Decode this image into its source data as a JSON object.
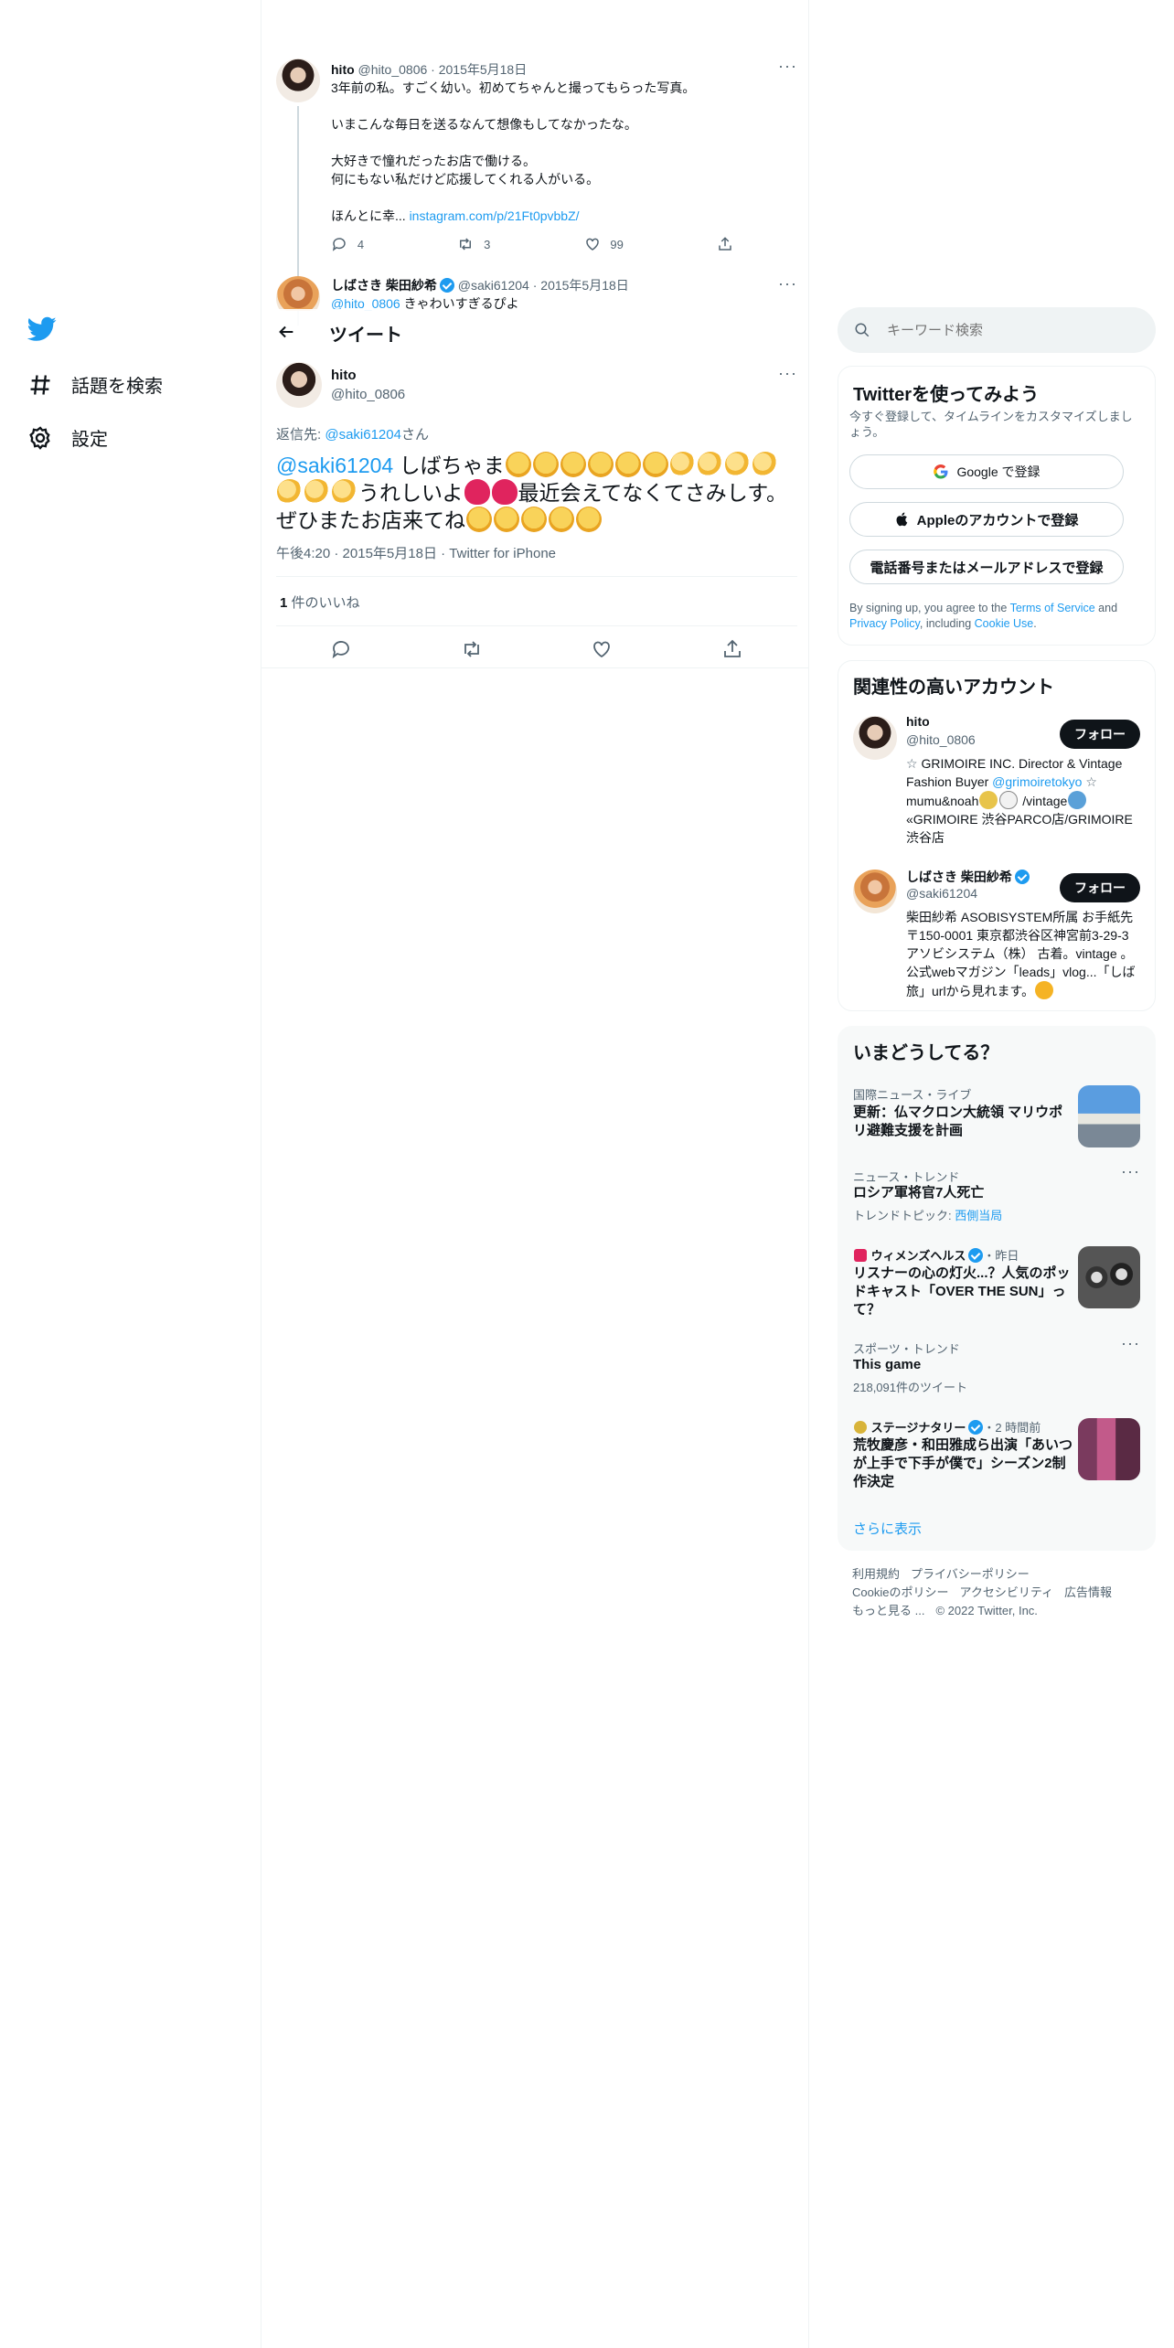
{
  "sidebar": {
    "explore_label": "話題を検索",
    "settings_label": "設定"
  },
  "thread_tweet": {
    "display_name": "hito",
    "handle": "@hito_0806",
    "date": "2015年5月18日",
    "line1": "3年前の私。すごく幼い。初めてちゃんと撮ってもらった写真。",
    "line2": "いまこんな毎日を送るなんて想像もしてなかったな。",
    "line3": "大好きで憧れだったお店で働ける。",
    "line4": "何にもない私だけど応援してくれる人がいる。",
    "line5_prefix": "ほんとに幸...",
    "link": "instagram.com/p/21Ft0pvbbZ/",
    "replies": "4",
    "retweets": "3",
    "likes": "99"
  },
  "reply_tweet": {
    "display_name": "しばさき 柴田紗希",
    "handle": "@saki61204",
    "date": "2015年5月18日",
    "text_mention": "@hito_0806",
    "text": "きゃわいすぎるぴよ"
  },
  "header": {
    "title": "ツイート"
  },
  "main_tweet": {
    "display_name": "hito",
    "handle": "@hito_0806",
    "reply_prefix": "返信先: ",
    "reply_to": "@saki61204",
    "reply_suffix": "さん",
    "mention": "@saki61204",
    "text1": "しばちゃま",
    "text2": "うれしいよ",
    "text3": "最近会えてなくてさみしす。ぜひまたお店来てね",
    "time": "午後4:20",
    "date": "2015年5月18日",
    "source": "Twitter for iPhone",
    "like_count": "1",
    "like_label": "件のいいね"
  },
  "search": {
    "placeholder": "キーワード検索"
  },
  "signup": {
    "title": "Twitterを使ってみよう",
    "subtitle": "今すぐ登録して、タイムラインをカスタマイズしましょう。",
    "google_label": "Google で登録",
    "apple_label": "Appleのアカウントで登録",
    "phone_label": "電話番号またはメールアドレスで登録",
    "legal_prefix": "By signing up, you agree to the ",
    "terms": "Terms of Service",
    "and": " and ",
    "privacy": "Privacy Policy",
    "including": ", including ",
    "cookie": "Cookie Use",
    "period": "."
  },
  "related": {
    "title": "関連性の高いアカウント",
    "follow_label": "フォロー",
    "accounts": [
      {
        "name": "hito",
        "handle": "@hito_0806",
        "bio1": "GRIMOIRE INC. Director & Vintage Fashion Buyer",
        "bio_link": "@grimoiretokyo",
        "bio2": "mumu&noah",
        "bio3": "/vintage",
        "bio4": "GRIMOIRE 渋谷PARCO店/GRIMOIRE 渋谷店"
      },
      {
        "name": "しばさき 柴田紗希",
        "handle": "@saki61204",
        "bio": "柴田紗希 ASOBISYSTEM所属 お手紙先〒150-0001 東京都渋谷区神宮前3-29-3アソビシステム（株） 古着。vintage 。公式webマガジン「leads」vlog...「しば旅」urlから見れます。"
      }
    ]
  },
  "trends": {
    "title": "いまどうしてる？",
    "items": [
      {
        "meta": "国際ニュース・ライブ",
        "title": "更新：仏マクロン大統領 マリウポリ避難支援を計画"
      },
      {
        "meta": "ニュース・トレンド",
        "title": "ロシア軍将官7人死亡",
        "sub_prefix": "トレンドトピック: ",
        "sub_link": "西側当局"
      },
      {
        "meta_name": "ウィメンズヘルス",
        "meta_time": "・昨日",
        "title": "リスナーの心の灯火...？人気のポッドキャスト「OVER THE SUN」って？"
      },
      {
        "meta": "スポーツ・トレンド",
        "title": "This game",
        "sub": "218,091件のツイート"
      },
      {
        "meta_name": "ステージナタリー",
        "meta_time": "・2 時間前",
        "title": "荒牧慶彦・和田雅成ら出演「あいつが上手で下手が僕で」シーズン2制作決定"
      }
    ],
    "show_more": "さらに表示"
  },
  "footer": {
    "terms": "利用規約",
    "privacy": "プライバシーポリシー",
    "cookie": "Cookieのポリシー",
    "accessibility": "アクセシビリティ",
    "ads": "広告情報",
    "more": "もっと見る ...",
    "copyright": "© 2022 Twitter, Inc."
  }
}
